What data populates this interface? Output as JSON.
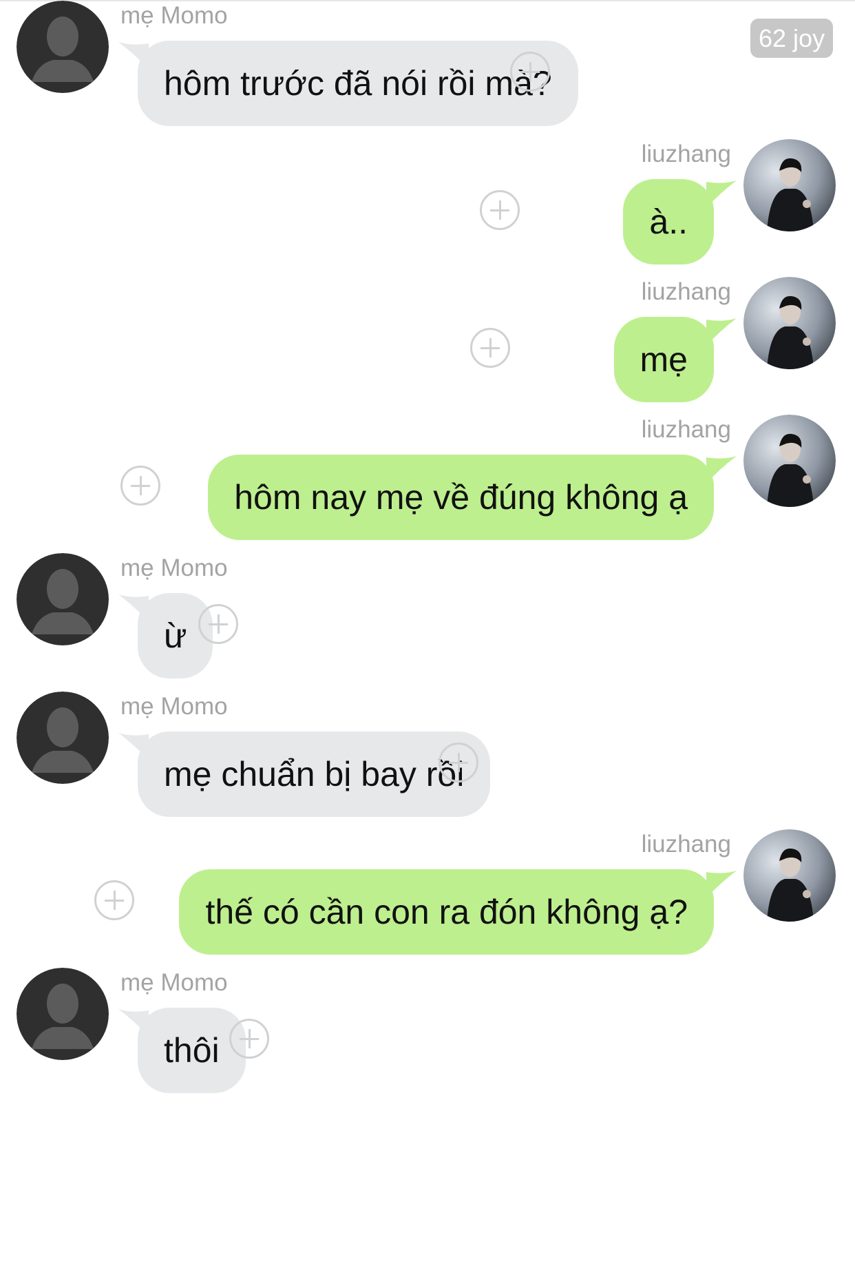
{
  "badge": "62 joy",
  "messages": [
    {
      "side": "left",
      "sender": "mẹ Momo",
      "text": "hôm trước đã nói rồi mà?"
    },
    {
      "side": "right",
      "sender": "liuzhang",
      "text": "à.."
    },
    {
      "side": "right",
      "sender": "liuzhang",
      "text": "mẹ"
    },
    {
      "side": "right",
      "sender": "liuzhang",
      "text": "hôm nay mẹ về đúng không ạ"
    },
    {
      "side": "left",
      "sender": "mẹ Momo",
      "text": "ừ"
    },
    {
      "side": "left",
      "sender": "mẹ Momo",
      "text": "mẹ chuẩn bị bay rồi"
    },
    {
      "side": "right",
      "sender": "liuzhang",
      "text": "thế có cần con ra đón không ạ?"
    },
    {
      "side": "left",
      "sender": "mẹ Momo",
      "text": "thôi"
    }
  ],
  "icons": {
    "placeholder_avatar": "person-silhouette-icon",
    "user_avatar": "profile-photo",
    "reaction": "plus-circle-icon"
  },
  "colors": {
    "incoming_bubble": "#e6e8ea",
    "outgoing_bubble": "#bdef8e",
    "sender_name": "#a3a3a3",
    "badge_bg": "#c7c7c7"
  }
}
